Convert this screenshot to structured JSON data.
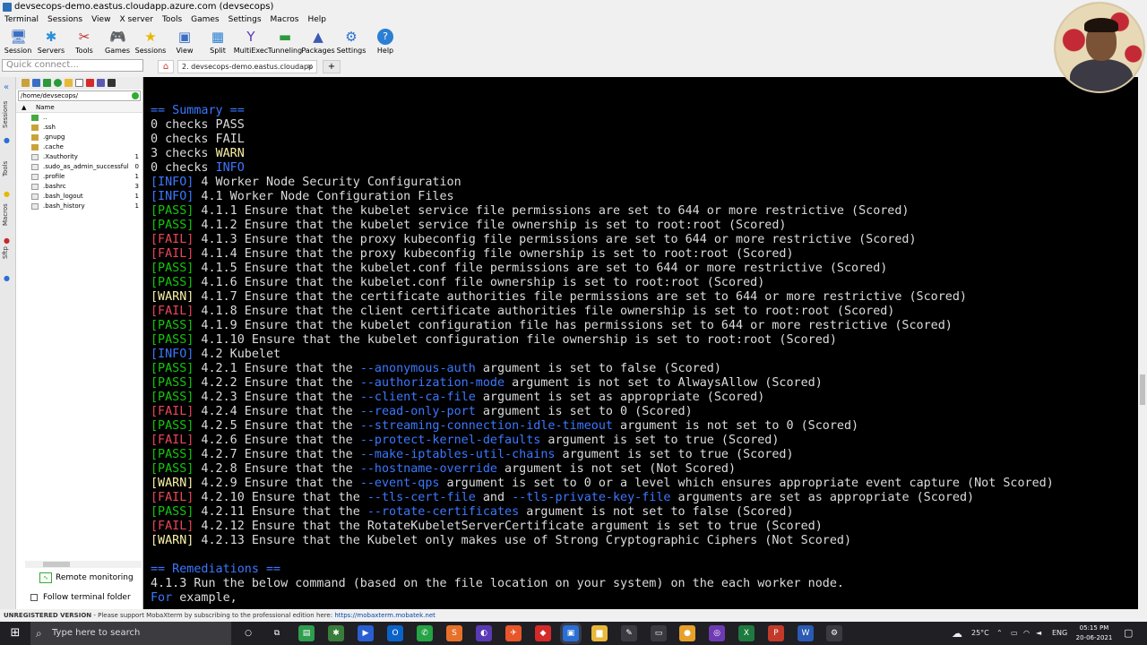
{
  "window": {
    "title": "devsecops-demo.eastus.cloudapp.azure.com (devsecops)"
  },
  "menu": [
    "Terminal",
    "Sessions",
    "View",
    "X server",
    "Tools",
    "Games",
    "Settings",
    "Macros",
    "Help"
  ],
  "toolbar": [
    {
      "label": "Session",
      "icon": "session-icon",
      "glyph": "🖥",
      "color": "#3a6fc4"
    },
    {
      "label": "Servers",
      "icon": "servers-icon",
      "glyph": "✱",
      "color": "#2b8fd8"
    },
    {
      "label": "Tools",
      "icon": "tools-icon",
      "glyph": "✂",
      "color": "#c42a2a"
    },
    {
      "label": "Games",
      "icon": "games-icon",
      "glyph": "🎮",
      "color": "#444"
    },
    {
      "label": "Sessions",
      "icon": "star-icon",
      "glyph": "★",
      "color": "#e6b800"
    },
    {
      "label": "View",
      "icon": "view-icon",
      "glyph": "▣",
      "color": "#3a6fc4"
    },
    {
      "label": "Split",
      "icon": "split-icon",
      "glyph": "▦",
      "color": "#2a7fd4"
    },
    {
      "label": "MultiExec",
      "icon": "multiexec-icon",
      "glyph": "Y",
      "color": "#5a3ab4"
    },
    {
      "label": "Tunneling",
      "icon": "tunneling-icon",
      "glyph": "▬",
      "color": "#2a9a3a"
    },
    {
      "label": "Packages",
      "icon": "packages-icon",
      "glyph": "▲",
      "color": "#3a5ab4"
    },
    {
      "label": "Settings",
      "icon": "gear-icon",
      "glyph": "⚙",
      "color": "#2a6fd4"
    },
    {
      "label": "Help",
      "icon": "help-icon",
      "glyph": "?",
      "color": "#fff"
    }
  ],
  "quick_connect": {
    "placeholder": "Quick connect..."
  },
  "tabs": {
    "session_label": "2. devsecops-demo.eastus.cloudapp",
    "add": "+"
  },
  "sidebar_tabs": [
    "Sessions",
    "Tools",
    "Macros",
    "Sftp"
  ],
  "file_browser": {
    "path": "/home/devsecops/",
    "column": "Name",
    "items": [
      {
        "name": "..",
        "type": "up",
        "size": ""
      },
      {
        "name": ".ssh",
        "type": "folder",
        "size": ""
      },
      {
        "name": ".gnupg",
        "type": "folder",
        "size": ""
      },
      {
        "name": ".cache",
        "type": "folder",
        "size": ""
      },
      {
        "name": ".Xauthority",
        "type": "file",
        "size": "1"
      },
      {
        "name": ".sudo_as_admin_successful",
        "type": "file",
        "size": "0"
      },
      {
        "name": ".profile",
        "type": "file",
        "size": "1"
      },
      {
        "name": ".bashrc",
        "type": "file",
        "size": "3"
      },
      {
        "name": ".bash_logout",
        "type": "file",
        "size": "1"
      },
      {
        "name": ".bash_history",
        "type": "file",
        "size": "1"
      }
    ],
    "remote_monitoring": "Remote monitoring",
    "follow_folder": "Follow terminal folder"
  },
  "colors": {
    "pass": "#16c60c",
    "fail": "#e74856",
    "warn": "#f9f1a5",
    "info": "#3b78ff",
    "section": "#3b78ff",
    "text": "#dcdcdc",
    "cmd": "#3b78ff"
  },
  "terminal": [
    {
      "k": "section",
      "text": "== Summary =="
    },
    {
      "k": "plain",
      "text": "0 checks PASS"
    },
    {
      "k": "plain",
      "text": "0 checks FAIL"
    },
    {
      "k": "warnline",
      "pre": "3 checks ",
      "tag": "WARN",
      "post": ""
    },
    {
      "k": "infoline",
      "pre": "0 checks ",
      "tag": "INFO",
      "post": ""
    },
    {
      "k": "info",
      "tag": "[INFO]",
      "text": " 4 Worker Node Security Configuration"
    },
    {
      "k": "info",
      "tag": "[INFO]",
      "text": " 4.1 Worker Node Configuration Files"
    },
    {
      "k": "pass",
      "tag": "[PASS]",
      "text": " 4.1.1 Ensure that the kubelet service file permissions are set to 644 or more restrictive (Scored)"
    },
    {
      "k": "pass",
      "tag": "[PASS]",
      "text": " 4.1.2 Ensure that the kubelet service file ownership is set to root:root (Scored)"
    },
    {
      "k": "fail",
      "tag": "[FAIL]",
      "text": " 4.1.3 Ensure that the proxy kubeconfig file permissions are set to 644 or more restrictive (Scored)"
    },
    {
      "k": "fail",
      "tag": "[FAIL]",
      "text": " 4.1.4 Ensure that the proxy kubeconfig file ownership is set to root:root (Scored)"
    },
    {
      "k": "pass",
      "tag": "[PASS]",
      "text": " 4.1.5 Ensure that the kubelet.conf file permissions are set to 644 or more restrictive (Scored)"
    },
    {
      "k": "pass",
      "tag": "[PASS]",
      "text": " 4.1.6 Ensure that the kubelet.conf file ownership is set to root:root (Scored)"
    },
    {
      "k": "warn",
      "tag": "[WARN]",
      "text": " 4.1.7 Ensure that the certificate authorities file permissions are set to 644 or more restrictive (Scored)"
    },
    {
      "k": "fail",
      "tag": "[FAIL]",
      "text": " 4.1.8 Ensure that the client certificate authorities file ownership is set to root:root (Scored)"
    },
    {
      "k": "pass",
      "tag": "[PASS]",
      "text": " 4.1.9 Ensure that the kubelet configuration file has permissions set to 644 or more restrictive (Scored)"
    },
    {
      "k": "pass",
      "tag": "[PASS]",
      "text": " 4.1.10 Ensure that the kubelet configuration file ownership is set to root:root (Scored)"
    },
    {
      "k": "info",
      "tag": "[INFO]",
      "text": " 4.2 Kubelet"
    },
    {
      "k": "pass",
      "tag": "[PASS]",
      "pre": " 4.2.1 Ensure that the ",
      "cmd": "--anonymous-auth",
      "post": " argument is set to false (Scored)"
    },
    {
      "k": "pass",
      "tag": "[PASS]",
      "pre": " 4.2.2 Ensure that the ",
      "cmd": "--authorization-mode",
      "post": " argument is not set to AlwaysAllow (Scored)"
    },
    {
      "k": "pass",
      "tag": "[PASS]",
      "pre": " 4.2.3 Ensure that the ",
      "cmd": "--client-ca-file",
      "post": " argument is set as appropriate (Scored)"
    },
    {
      "k": "fail",
      "tag": "[FAIL]",
      "pre": " 4.2.4 Ensure that the ",
      "cmd": "--read-only-port",
      "post": " argument is set to 0 (Scored)"
    },
    {
      "k": "pass",
      "tag": "[PASS]",
      "pre": " 4.2.5 Ensure that the ",
      "cmd": "--streaming-connection-idle-timeout",
      "post": " argument is not set to 0 (Scored)"
    },
    {
      "k": "fail",
      "tag": "[FAIL]",
      "pre": " 4.2.6 Ensure that the ",
      "cmd": "--protect-kernel-defaults",
      "post": " argument is set to true (Scored)"
    },
    {
      "k": "pass",
      "tag": "[PASS]",
      "pre": " 4.2.7 Ensure that the ",
      "cmd": "--make-iptables-util-chains",
      "post": " argument is set to true (Scored)"
    },
    {
      "k": "pass",
      "tag": "[PASS]",
      "pre": " 4.2.8 Ensure that the ",
      "cmd": "--hostname-override",
      "post": " argument is not set (Not Scored)"
    },
    {
      "k": "warn",
      "tag": "[WARN]",
      "pre": " 4.2.9 Ensure that the ",
      "cmd": "--event-qps",
      "post": " argument is set to 0 or a level which ensures appropriate event capture (Not Scored)"
    },
    {
      "k": "fail",
      "tag": "[FAIL]",
      "pre": " 4.2.10 Ensure that the ",
      "cmd": "--tls-cert-file",
      "mid": " and ",
      "cmd2": "--tls-private-key-file",
      "post": " arguments are set as appropriate (Scored)"
    },
    {
      "k": "pass",
      "tag": "[PASS]",
      "pre": " 4.2.11 Ensure that the ",
      "cmd": "--rotate-certificates",
      "post": " argument is not set to false (Scored)"
    },
    {
      "k": "fail",
      "tag": "[FAIL]",
      "text": " 4.2.12 Ensure that the RotateKubeletServerCertificate argument is set to true (Scored)"
    },
    {
      "k": "warn",
      "tag": "[WARN]",
      "text": " 4.2.13 Ensure that the Kubelet only makes use of Strong Cryptographic Ciphers (Not Scored)"
    },
    {
      "k": "blank",
      "text": ""
    },
    {
      "k": "section",
      "text": "== Remediations =="
    },
    {
      "k": "plain",
      "text": "4.1.3 Run the below command (based on the file location on your system) on the each worker node."
    },
    {
      "k": "plainfor",
      "tag": "For",
      "text": " example,"
    }
  ],
  "status": {
    "unregistered": "UNREGISTERED VERSION",
    "message": "  -  Please support MobaXterm by subscribing to the professional edition here: ",
    "link": "https://mobaxterm.mobatek.net"
  },
  "taskbar": {
    "search_placeholder": "Type here to search",
    "apps": [
      {
        "icon": "task-view-icon",
        "glyph": "○",
        "bg": "transparent"
      },
      {
        "icon": "timeline-icon",
        "glyph": "⧉",
        "bg": "transparent"
      },
      {
        "icon": "notepad-icon",
        "glyph": "▤",
        "bg": "#2e9d4e"
      },
      {
        "icon": "app-icon",
        "glyph": "✱",
        "bg": "#3a7d3a"
      },
      {
        "icon": "remote-desktop-icon",
        "glyph": "▶",
        "bg": "#2a5fd4"
      },
      {
        "icon": "outlook-icon",
        "glyph": "O",
        "bg": "#0a64c8"
      },
      {
        "icon": "whatsapp-icon",
        "glyph": "✆",
        "bg": "#25a345"
      },
      {
        "icon": "sublime-icon",
        "glyph": "S",
        "bg": "#e8712a"
      },
      {
        "icon": "vpn-icon",
        "glyph": "◐",
        "bg": "#5a3ab4"
      },
      {
        "icon": "postman-icon",
        "glyph": "✈",
        "bg": "#e8562a"
      },
      {
        "icon": "pdf-icon",
        "glyph": "◆",
        "bg": "#d42a2a"
      },
      {
        "icon": "mobaxterm-icon",
        "glyph": "▣",
        "bg": "#2a6fd4"
      },
      {
        "icon": "file-explorer-icon",
        "glyph": "▆",
        "bg": "#e8b83a"
      },
      {
        "icon": "tools-icon",
        "glyph": "✎",
        "bg": "#3a3a40"
      },
      {
        "icon": "terminal-icon",
        "glyph": "▭",
        "bg": "#3a3a40"
      },
      {
        "icon": "chrome-icon",
        "glyph": "●",
        "bg": "#e8a02a"
      },
      {
        "icon": "github-icon",
        "glyph": "◎",
        "bg": "#6e3ab4"
      },
      {
        "icon": "excel-icon",
        "glyph": "X",
        "bg": "#1e7a3e"
      },
      {
        "icon": "powerpoint-icon",
        "glyph": "P",
        "bg": "#c43a2a"
      },
      {
        "icon": "word-icon",
        "glyph": "W",
        "bg": "#2a5ab4"
      },
      {
        "icon": "settings-icon",
        "glyph": "⚙",
        "bg": "#3a3a40"
      }
    ],
    "temperature": "25°C",
    "language": "ENG",
    "time": "05:15 PM",
    "date": "20-06-2021"
  }
}
